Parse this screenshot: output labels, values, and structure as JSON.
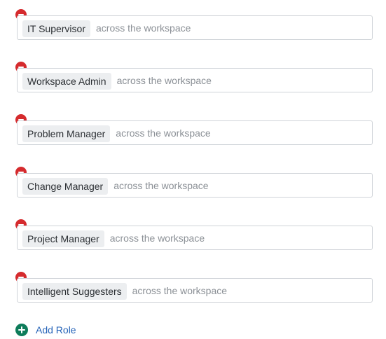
{
  "roles": [
    {
      "name": "IT Supervisor",
      "scope": "across the workspace"
    },
    {
      "name": "Workspace Admin",
      "scope": "across the workspace"
    },
    {
      "name": "Problem Manager",
      "scope": "across the workspace"
    },
    {
      "name": "Change Manager",
      "scope": "across the workspace"
    },
    {
      "name": "Project Manager",
      "scope": "across the workspace"
    },
    {
      "name": "Intelligent Suggesters",
      "scope": "across the workspace"
    }
  ],
  "add_role": {
    "label": "Add Role",
    "icon": "plus-circle-icon"
  },
  "icons": {
    "remove": "minus-circle-icon"
  },
  "colors": {
    "remove": "#d52b2e",
    "add": "#0e7c5a",
    "link": "#2563b8",
    "scope_text": "#8b9096",
    "chip_bg": "#eceef0"
  }
}
